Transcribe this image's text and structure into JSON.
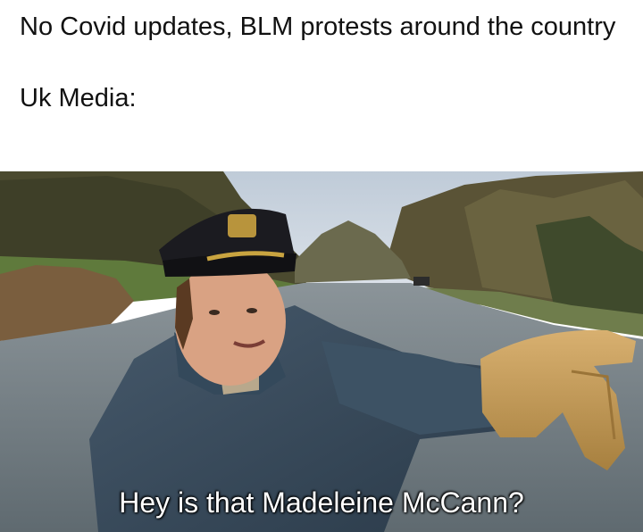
{
  "meme": {
    "caption_line": "No Covid updates, BLM protests around the country",
    "caption_label": "Uk Media:",
    "subtitle": "Hey is that Madeleine McCann?"
  },
  "colors": {
    "sky": "#c9d4df",
    "water": "#6f7a80",
    "jacket": "#3b4f60",
    "glove": "#c9a05c",
    "cap": "#1b1b20"
  }
}
